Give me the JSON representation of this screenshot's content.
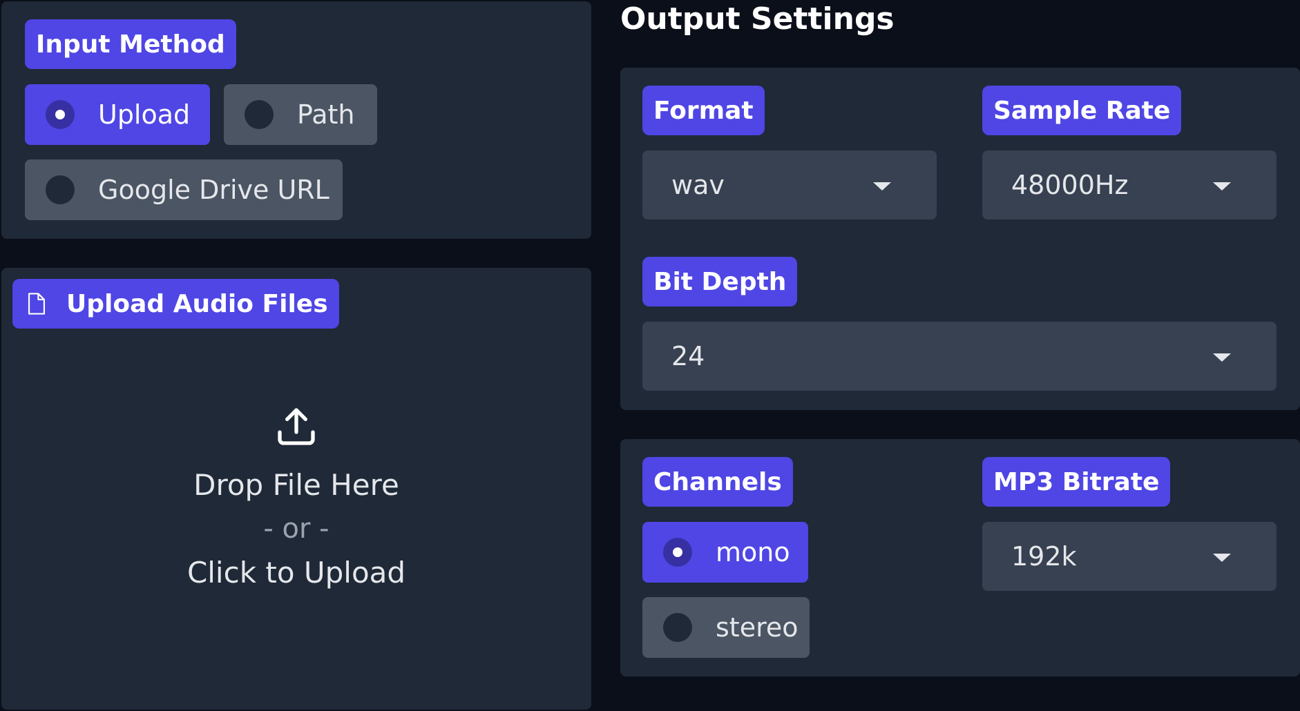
{
  "input_method": {
    "label": "Input Method",
    "options": [
      "Upload",
      "Path",
      "Google Drive URL"
    ],
    "selected": "Upload"
  },
  "upload": {
    "label": "Upload Audio Files",
    "drop_text": "Drop File Here",
    "or_text": "- or -",
    "click_text": "Click to Upload"
  },
  "output": {
    "title": "Output Settings",
    "format": {
      "label": "Format",
      "value": "wav"
    },
    "sample_rate": {
      "label": "Sample Rate",
      "value": "48000Hz"
    },
    "bit_depth": {
      "label": "Bit Depth",
      "value": "24"
    },
    "channels": {
      "label": "Channels",
      "options": [
        "mono",
        "stereo"
      ],
      "selected": "mono"
    },
    "mp3_bitrate": {
      "label": "MP3 Bitrate",
      "value": "192k"
    }
  },
  "colors": {
    "accent": "#4f46e5",
    "background": "#0b0f19",
    "panel": "#1f2937",
    "control": "#374151",
    "unselected_option": "#4b5563"
  },
  "icons": {
    "upload_label": "file-icon",
    "drop_zone": "upload-icon",
    "dropdown": "caret-down-icon"
  }
}
